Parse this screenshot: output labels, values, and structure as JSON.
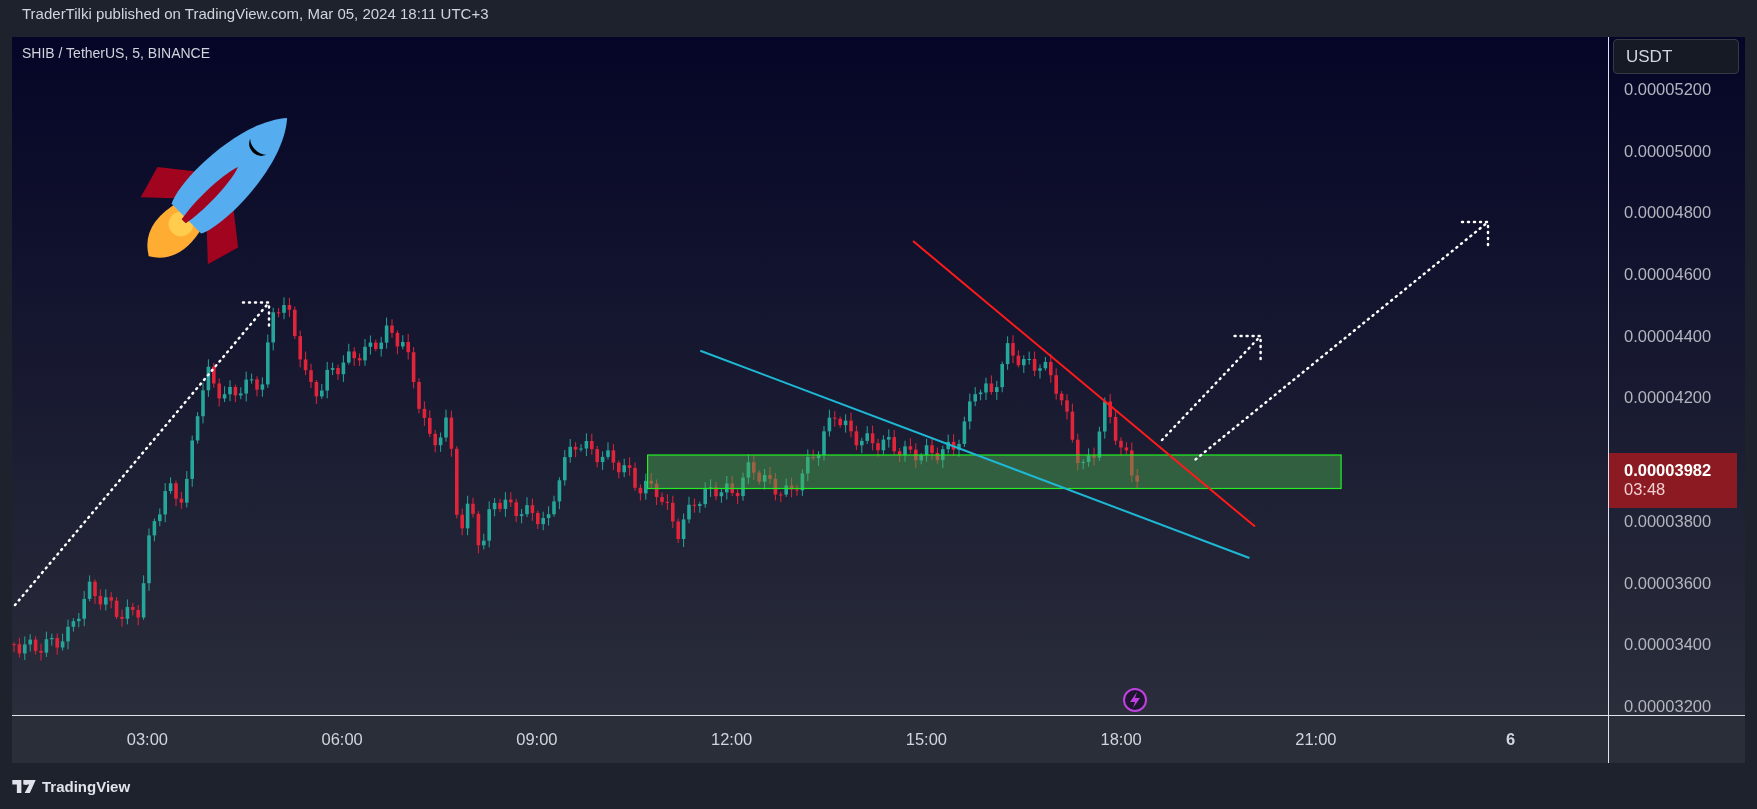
{
  "header": {
    "text": "TraderTilki published on TradingView.com, Mar 05, 2024 18:11 UTC+3"
  },
  "chart": {
    "legend": "SHIB / TetherUS, 5, BINANCE"
  },
  "price_axis": {
    "currency": "USDT",
    "ticks_above": [
      "0.00005200",
      "0.00005000",
      "0.00004800",
      "0.00004600",
      "0.00004400",
      "0.00004200"
    ],
    "last_price": {
      "value": "0.00003982",
      "countdown": "03:48",
      "falling": true
    },
    "ticks_below": [
      "0.00003800",
      "0.00003600",
      "0.00003400",
      "0.00003200"
    ]
  },
  "time_axis": {
    "ticks": [
      {
        "label": "03:00",
        "kind": "time"
      },
      {
        "label": "06:00",
        "kind": "time"
      },
      {
        "label": "09:00",
        "kind": "time"
      },
      {
        "label": "12:00",
        "kind": "time"
      },
      {
        "label": "15:00",
        "kind": "time"
      },
      {
        "label": "18:00",
        "kind": "time"
      },
      {
        "label": "21:00",
        "kind": "time"
      },
      {
        "label": "6",
        "kind": "day"
      }
    ]
  },
  "footer": {
    "brand": "TradingView"
  }
}
